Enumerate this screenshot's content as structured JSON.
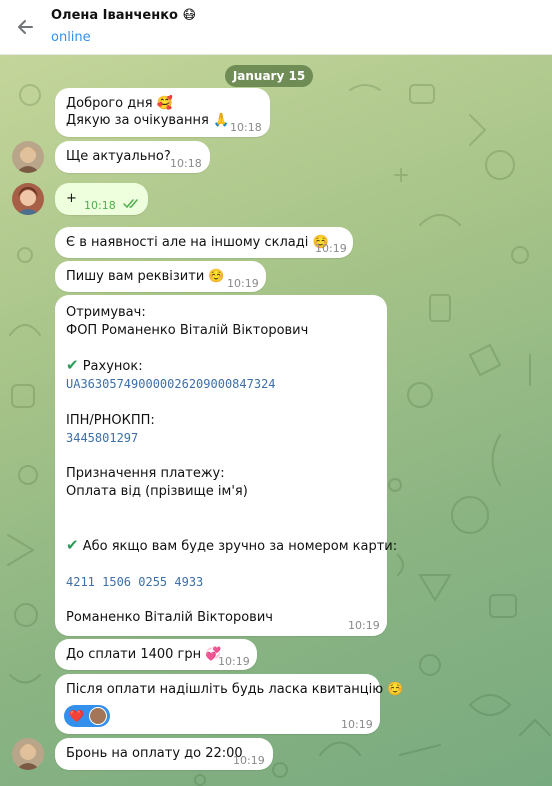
{
  "header": {
    "contact_name": "Олена Іванченко",
    "name_emoji": "😷",
    "status": "online"
  },
  "chat": {
    "date": "January 15",
    "messages": [
      {
        "lines": [
          "Доброго дня 🥰",
          "Дякую за очікування 🙏"
        ],
        "time": "10:18",
        "dir": "in"
      },
      {
        "lines": [
          "Ще актуально?"
        ],
        "time": "10:18",
        "dir": "in"
      },
      {
        "lines": [
          "+"
        ],
        "time": "10:18",
        "dir": "out",
        "status": "read"
      },
      {
        "lines": [
          "Є в наявності але на іншому складі ☺️"
        ],
        "time": "10:19",
        "dir": "in"
      },
      {
        "lines": [
          "Пишу вам реквізити ☺️"
        ],
        "time": "10:19",
        "dir": "in"
      },
      {
        "recipient_label": "Отримувач:",
        "recipient_name": "ФОП Романенко Віталій Вікторович",
        "account_label": "Рахунок:",
        "iban": "UA363057490000026209000847324",
        "tax_label": "ІПН/РНОКПП:",
        "tax_id": "3445801297",
        "purpose_label": "Призначення платежу:",
        "purpose_value": "Оплата від (прізвище ім'я)",
        "card_label": "Або якщо вам буде зручно за номером карти:",
        "card_number": "4211 1506 0255 4933",
        "card_holder": "Романенко Віталій Вікторович",
        "time": "10:19",
        "dir": "in"
      },
      {
        "lines": [
          "До сплати 1400 грн 💞"
        ],
        "time": "10:19",
        "dir": "in"
      },
      {
        "lines": [
          "Після оплати надішліть будь ласка квитанцію ☺️"
        ],
        "time": "10:19",
        "dir": "in",
        "reaction": "❤️"
      },
      {
        "lines": [
          "Бронь на оплату до 22:00"
        ],
        "time": "10:19",
        "dir": "in"
      }
    ]
  },
  "colors": {
    "accent": "#3390ec",
    "outgoing_bubble": "#eeffde",
    "read_check": "#4fae4e",
    "date_pill": "#53733f"
  }
}
